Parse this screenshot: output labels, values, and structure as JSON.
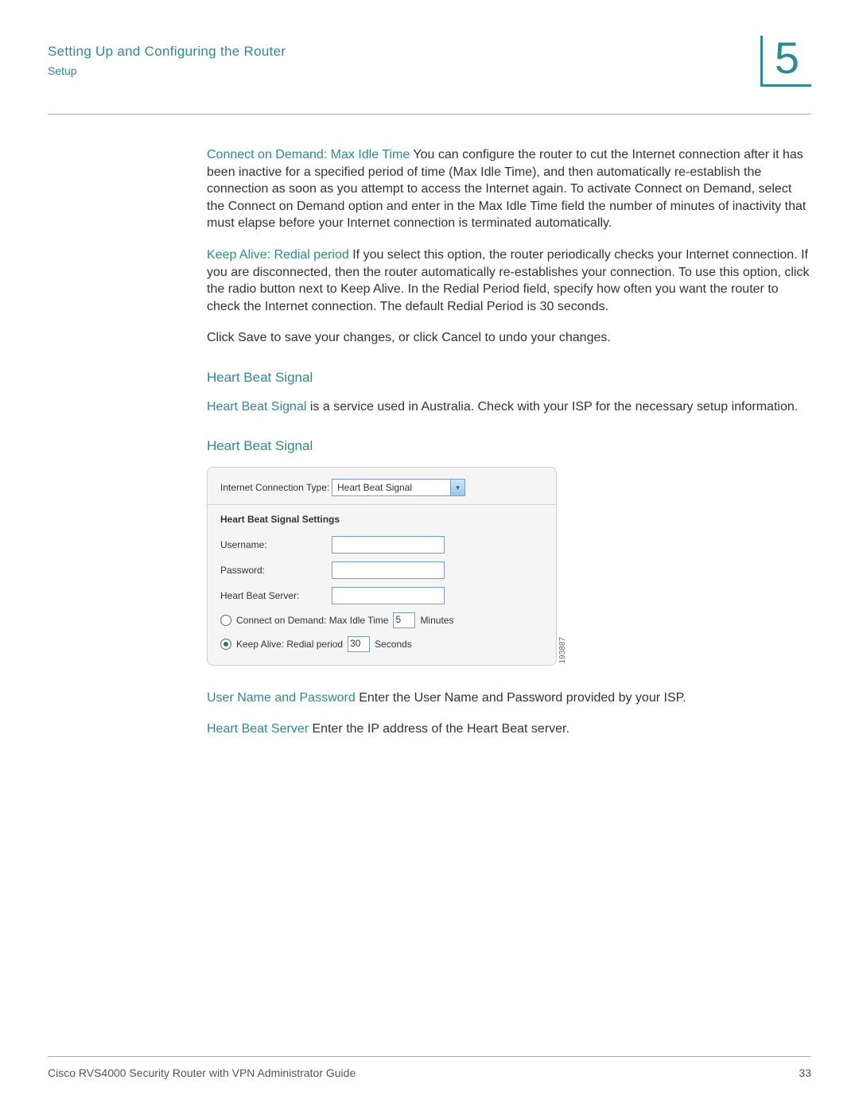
{
  "header": {
    "title": "Setting Up and Configuring the Router",
    "subtitle": "Setup",
    "chapter": "5"
  },
  "body": {
    "p1_label": "Connect on Demand: Max Idle Time",
    "p1_text": " You can configure the router to cut the Internet connection after it has been inactive for a specified period of time (Max Idle Time), and then automatically re-establish the connection as soon as you attempt to access the Internet again. To activate Connect on Demand, select the Connect on Demand option and enter in the Max Idle Time field the number of minutes of inactivity that must elapse before your Internet connection is terminated automatically.",
    "p2_label": "Keep Alive: Redial period",
    "p2_text": " If you select this option, the router periodically checks your Internet connection. If you are disconnected, then the router automatically re-establishes your connection. To use this option, click the radio button next to Keep Alive. In the Redial Period field, specify how often you want the router to check the Internet connection. The default Redial Period is 30 seconds.",
    "p3": "Click Save to save your changes, or click Cancel to undo your changes.",
    "hbs_head": "Heart Beat Signal",
    "hbs_label": "Heart Beat Signal",
    "hbs_text": " is a service used in Australia. Check with your ISP for the necessary setup information.",
    "hbs_head2": "Heart Beat Signal",
    "p_user_label": "User Name and Password",
    "p_user_text": " Enter the User Name and Password provided by your ISP.",
    "p_server_label": "Heart Beat Server",
    "p_server_text": " Enter the IP address of the Heart Beat server."
  },
  "panel": {
    "conn_type_label": "Internet Connection Type:",
    "conn_type_value": "Heart Beat Signal",
    "settings_head": "Heart Beat Signal Settings",
    "username_label": "Username:",
    "password_label": "Password:",
    "server_label": "Heart Beat Server:",
    "cod_label": "Connect on Demand: Max Idle Time",
    "cod_value": "5",
    "cod_unit": "Minutes",
    "ka_label": "Keep Alive: Redial period",
    "ka_value": "30",
    "ka_unit": "Seconds",
    "figure_id": "193887"
  },
  "footer": {
    "left": "Cisco RVS4000 Security Router with VPN Administrator Guide",
    "right": "33"
  }
}
